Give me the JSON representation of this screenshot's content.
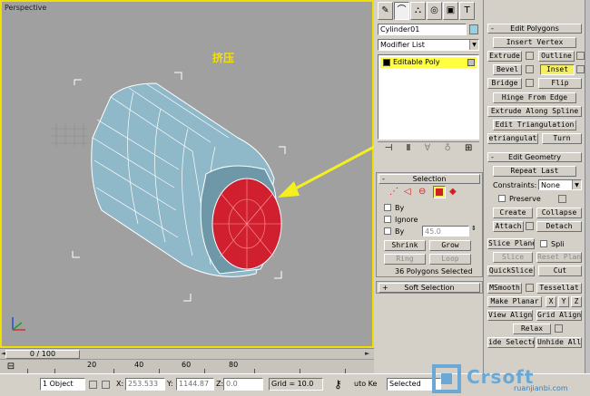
{
  "viewport": {
    "label": "Perspective",
    "annotation": "挤压"
  },
  "timeslider": {
    "label": "0 / 100"
  },
  "trackbar": {
    "ticks": [
      "20",
      "40",
      "60",
      "80"
    ]
  },
  "command_panel": {
    "object_name": "Cylinder01",
    "modifier_list": "Modifier List",
    "stack_item": "Editable Poly",
    "selection": {
      "title": "Selection",
      "by_vertex": "By",
      "ignore": "Ignore",
      "by_angle": "By",
      "angle_value": "45.0",
      "shrink": "Shrink",
      "grow": "Grow",
      "ring": "Ring",
      "loop": "Loop",
      "status": "36 Polygons Selected"
    },
    "soft_selection": {
      "title": "Soft Selection"
    }
  },
  "edit_polygons": {
    "title": "Edit Polygons",
    "insert_vertex": "Insert Vertex",
    "extrude": "Extrude",
    "outline": "Outline",
    "bevel": "Bevel",
    "inset": "Inset",
    "bridge": "Bridge",
    "flip": "Flip",
    "hinge_from_edge": "Hinge From Edge",
    "extrude_along_spline": "Extrude Along Spline",
    "edit_triangulation": "Edit Triangulation",
    "retriangulate": "etriangulat",
    "turn": "Turn"
  },
  "edit_geometry": {
    "title": "Edit Geometry",
    "repeat_last": "Repeat Last",
    "constraints_label": "Constraints:",
    "constraints_value": "None",
    "preserve": "Preserve",
    "create": "Create",
    "collapse": "Collapse",
    "attach": "Attach",
    "detach": "Detach",
    "slice_plane": "Slice Plane",
    "split": "Spli",
    "slice": "Slice",
    "reset_plane": "Reset Plan",
    "quickslice": "QuickSlice",
    "cut": "Cut",
    "msmooth": "MSmooth",
    "tessellate": "Tessellat",
    "make_planar": "Make Planar",
    "x": "X",
    "y": "Y",
    "z": "Z",
    "view_align": "View Align",
    "grid_align": "Grid Align",
    "relax": "Relax",
    "hide_selected": "ide Selecte",
    "unhide_all": "Unhide All"
  },
  "statusbar": {
    "selection": "1 Object",
    "x_label": "X:",
    "x_value": "253.533",
    "y_label": "Y:",
    "y_value": "1144.87",
    "z_label": "Z:",
    "z_value": "0.0",
    "grid": "Grid = 10.0",
    "auto_key": "uto Ke",
    "key_filter": "Selected"
  },
  "watermark": {
    "brand": "Crsoft",
    "sub": "ruanjianbi.com"
  }
}
